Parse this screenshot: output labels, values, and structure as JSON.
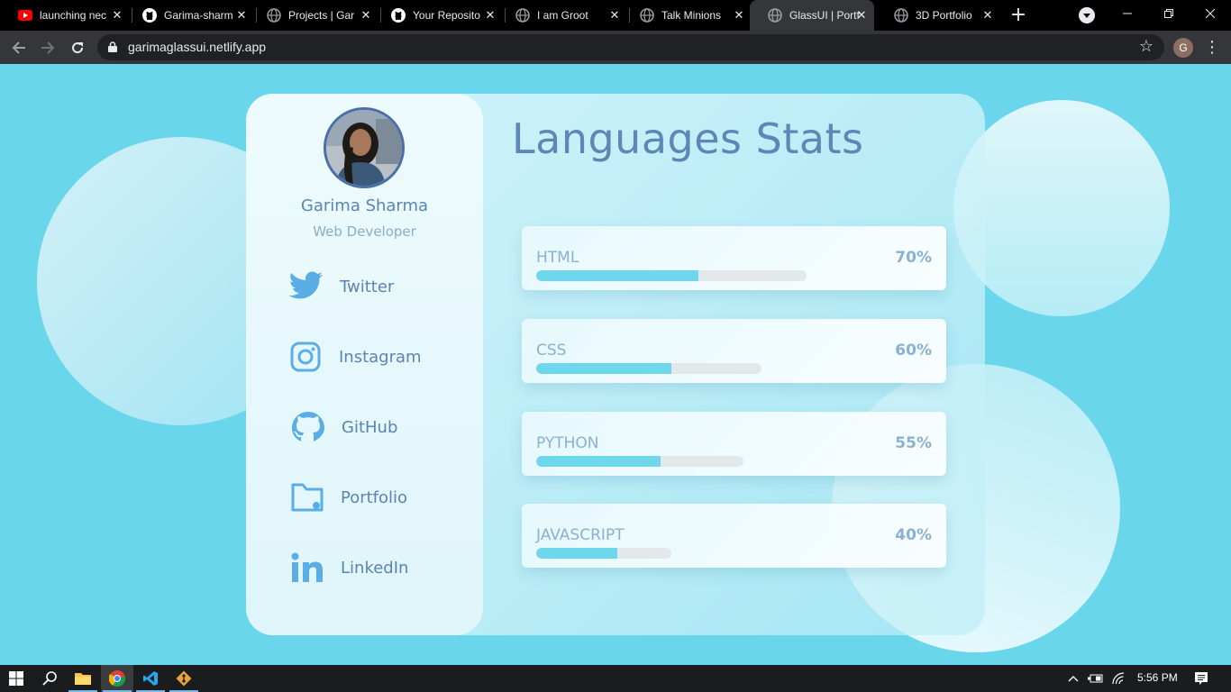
{
  "browser": {
    "tabs": [
      {
        "title": "launching nec",
        "icon": "youtube-icon",
        "active": false
      },
      {
        "title": "Garima-sharm",
        "icon": "github-icon",
        "active": false
      },
      {
        "title": "Projects | Gar",
        "icon": "globe-icon",
        "active": false
      },
      {
        "title": "Your Reposito",
        "icon": "github-icon",
        "active": false
      },
      {
        "title": "I am Groot",
        "icon": "globe-icon",
        "active": false
      },
      {
        "title": "Talk Minions",
        "icon": "globe-icon",
        "active": false
      },
      {
        "title": "GlassUI | Portf",
        "icon": "globe-icon",
        "active": true
      },
      {
        "title": "3D Portfolio",
        "icon": "globe-icon",
        "active": false
      }
    ],
    "new_tab": "+",
    "url": "garimaglassui.netlify.app",
    "profile_initial": "G"
  },
  "sidebar": {
    "name": "Garima Sharma",
    "role": "Web Developer",
    "links": [
      {
        "label": "Twitter",
        "icon": "twitter-icon"
      },
      {
        "label": "Instagram",
        "icon": "instagram-icon"
      },
      {
        "label": "GitHub",
        "icon": "github-icon"
      },
      {
        "label": "Portfolio",
        "icon": "folder-icon"
      },
      {
        "label": "LinkedIn",
        "icon": "linkedin-icon"
      }
    ]
  },
  "main": {
    "title": "Languages Stats",
    "skills": [
      {
        "name": "HTML",
        "percent_label": "70%",
        "fill": 0.6
      },
      {
        "name": "CSS",
        "percent_label": "60%",
        "fill": 0.6
      },
      {
        "name": "PYTHON",
        "percent_label": "55%",
        "fill": 0.6
      },
      {
        "name": "JAVASCRIPT",
        "percent_label": "40%",
        "fill": 0.6
      }
    ]
  },
  "taskbar": {
    "time": "5:56 PM"
  },
  "colors": {
    "background": "#6ad6ec",
    "accent_blue": "#5c84b1",
    "bar_fill": "#6fd7ec",
    "bar_track": "#e3e8ea"
  }
}
